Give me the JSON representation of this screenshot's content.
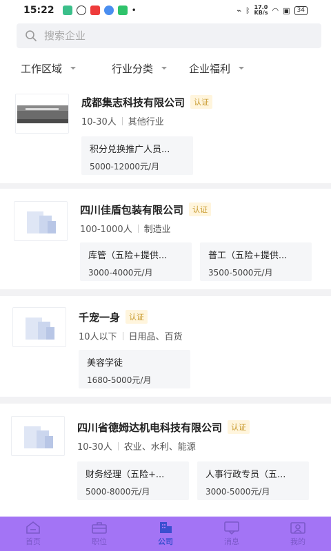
{
  "status_bar": {
    "time": "15:22",
    "network_speed": "17.0\nKB/s",
    "battery": "34"
  },
  "search": {
    "placeholder": "搜索企业"
  },
  "filters": [
    {
      "label": "工作区域"
    },
    {
      "label": "行业分类"
    },
    {
      "label": "企业福利"
    }
  ],
  "verified_label": "认证",
  "companies": [
    {
      "name": "成都集志科技有限公司",
      "size": "10-30人",
      "industry": "其他行业",
      "jobs": [
        {
          "title": "积分兑换推广人员...",
          "salary": "5000-12000元/月"
        }
      ]
    },
    {
      "name": "四川佳盾包装有限公司",
      "size": "100-1000人",
      "industry": "制造业",
      "jobs": [
        {
          "title": "库管（五险+提供...",
          "salary": "3000-4000元/月"
        },
        {
          "title": "普工（五险+提供...",
          "salary": "3500-5000元/月"
        }
      ]
    },
    {
      "name": "千宠一身",
      "size": "10人以下",
      "industry": "日用品、百货",
      "jobs": [
        {
          "title": "美容学徒",
          "salary": "1680-5000元/月"
        }
      ]
    },
    {
      "name": "四川省德姆达机电科技有限公司",
      "size": "10-30人",
      "industry": "农业、水利、能源",
      "jobs": [
        {
          "title": "财务经理（五险+...",
          "salary": "5000-8000元/月"
        },
        {
          "title": "人事行政专员（五...",
          "salary": "3000-5000元/月"
        }
      ]
    }
  ],
  "tabbar": [
    {
      "label": "首页",
      "icon": "home-icon"
    },
    {
      "label": "职位",
      "icon": "briefcase-icon"
    },
    {
      "label": "公司",
      "icon": "building-icon",
      "active": true
    },
    {
      "label": "消息",
      "icon": "message-icon"
    },
    {
      "label": "我的",
      "icon": "profile-icon"
    }
  ],
  "colors": {
    "tabbar": "#a374f5",
    "badge_bg": "#fff5dd",
    "badge_text": "#c89a2e",
    "active_tab": "#3b4fd0"
  }
}
